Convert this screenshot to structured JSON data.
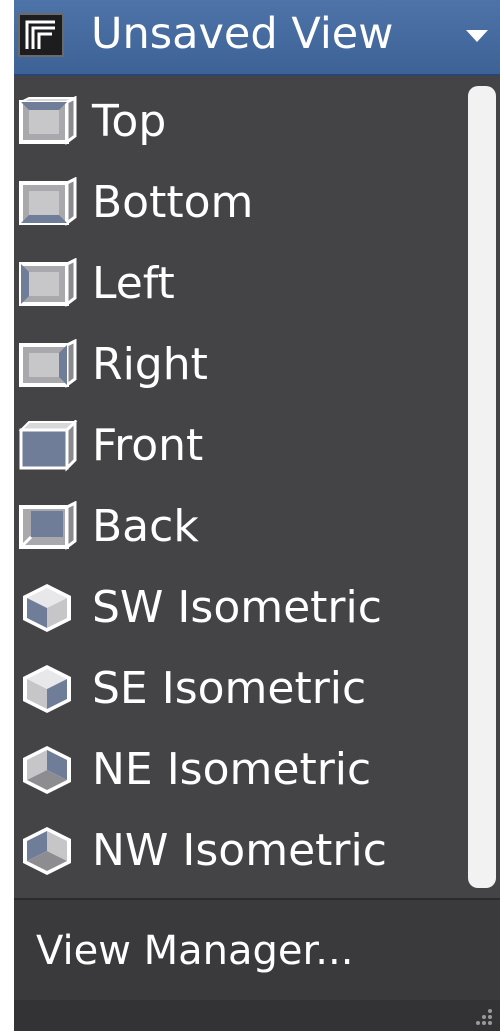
{
  "header": {
    "title": "Unsaved View",
    "icon": "named-views-icon",
    "dropdown_icon": "chevron-down-icon",
    "accent_color": "#4a6fa5"
  },
  "views": [
    {
      "label": "Top",
      "icon": "view-top-icon"
    },
    {
      "label": "Bottom",
      "icon": "view-bottom-icon"
    },
    {
      "label": "Left",
      "icon": "view-left-icon"
    },
    {
      "label": "Right",
      "icon": "view-right-icon"
    },
    {
      "label": "Front",
      "icon": "view-front-icon"
    },
    {
      "label": "Back",
      "icon": "view-back-icon"
    },
    {
      "label": "SW Isometric",
      "icon": "sw-isometric-icon"
    },
    {
      "label": "SE Isometric",
      "icon": "se-isometric-icon"
    },
    {
      "label": "NE Isometric",
      "icon": "ne-isometric-icon"
    },
    {
      "label": "NW Isometric",
      "icon": "nw-isometric-icon"
    }
  ],
  "footer": {
    "view_manager_label": "View Manager...",
    "grip_icon": "resize-grip-icon"
  },
  "colors": {
    "panel_background": "#444446",
    "footer_background": "#3a3a3c",
    "text": "#ffffff",
    "scrollbar": "#f2f2f2"
  }
}
